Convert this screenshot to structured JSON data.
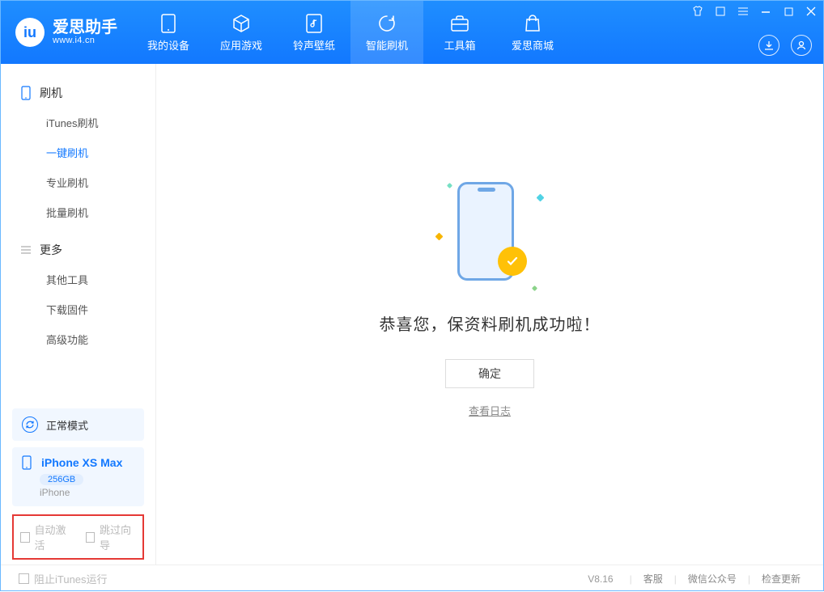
{
  "logo": {
    "title": "爱思助手",
    "site": "www.i4.cn",
    "mark": "iu"
  },
  "tabs": {
    "t0": "我的设备",
    "t1": "应用游戏",
    "t2": "铃声壁纸",
    "t3": "智能刷机",
    "t4": "工具箱",
    "t5": "爱思商城"
  },
  "sidebar": {
    "section1": "刷机",
    "items1": {
      "i0": "iTunes刷机",
      "i1": "一键刷机",
      "i2": "专业刷机",
      "i3": "批量刷机"
    },
    "section2": "更多",
    "items2": {
      "i0": "其他工具",
      "i1": "下载固件",
      "i2": "高级功能"
    },
    "mode": "正常模式",
    "device": {
      "name": "iPhone XS Max",
      "storage": "256GB",
      "type": "iPhone"
    },
    "checkboxes": {
      "c0": "自动激活",
      "c1": "跳过向导"
    }
  },
  "main": {
    "message": "恭喜您，保资料刷机成功啦！",
    "ok": "确定",
    "log_link": "查看日志"
  },
  "footer": {
    "block_itunes": "阻止iTunes运行",
    "version": "V8.16",
    "links": {
      "l0": "客服",
      "l1": "微信公众号",
      "l2": "检查更新"
    }
  }
}
